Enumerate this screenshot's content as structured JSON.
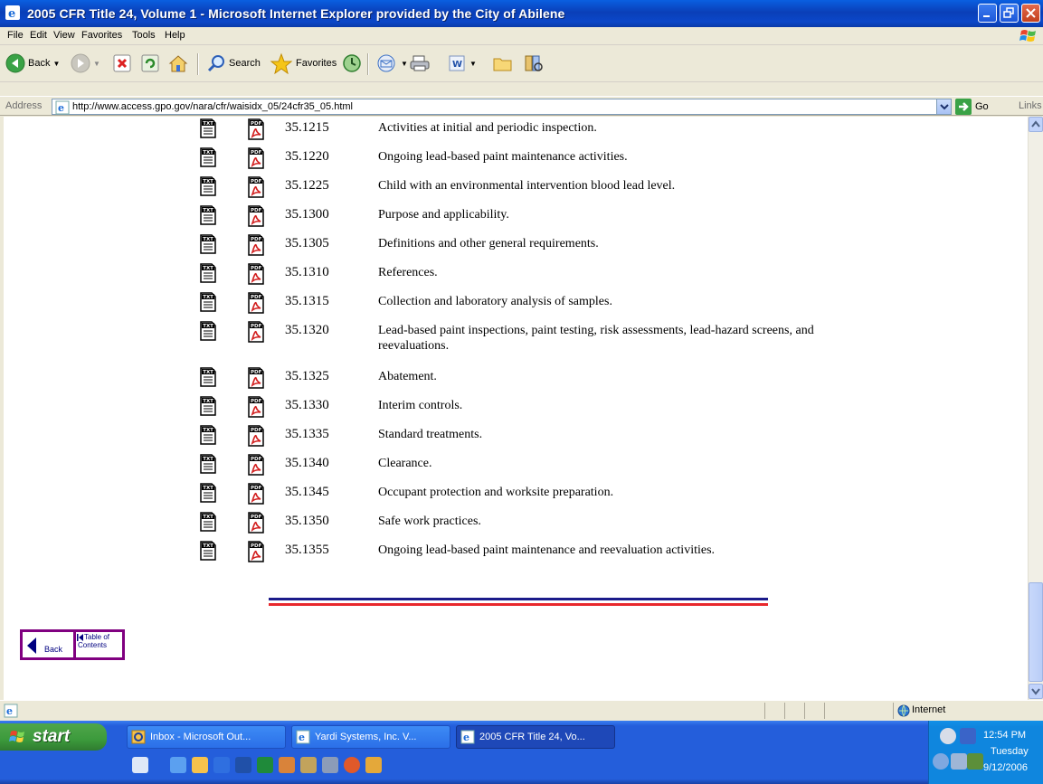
{
  "window": {
    "title": "2005 CFR Title 24, Volume 1 - Microsoft Internet Explorer provided by the City of Abilene"
  },
  "menu": [
    "File",
    "Edit",
    "View",
    "Favorites",
    "Tools",
    "Help"
  ],
  "toolbar": {
    "back_label": "Back",
    "search_label": "Search",
    "favorites_label": "Favorites"
  },
  "address": {
    "label": "Address",
    "url": "http://www.access.gpo.gov/nara/cfr/waisidx_05/24cfr35_05.html",
    "go_label": "Go",
    "links_label": "Links"
  },
  "sections": [
    {
      "number": "35.1215",
      "title": "Activities at initial and periodic inspection."
    },
    {
      "number": "35.1220",
      "title": "Ongoing lead-based paint maintenance activities."
    },
    {
      "number": "35.1225",
      "title": "Child with an environmental intervention blood lead level."
    },
    {
      "number": "35.1300",
      "title": "Purpose and applicability."
    },
    {
      "number": "35.1305",
      "title": "Definitions and other general requirements."
    },
    {
      "number": "35.1310",
      "title": "References."
    },
    {
      "number": "35.1315",
      "title": "Collection and laboratory analysis of samples."
    },
    {
      "number": "35.1320",
      "title": "Lead-based paint inspections, paint testing, risk assessments, lead-hazard screens, and reevaluations."
    },
    {
      "number": "35.1325",
      "title": "Abatement."
    },
    {
      "number": "35.1330",
      "title": "Interim controls."
    },
    {
      "number": "35.1335",
      "title": "Standard treatments."
    },
    {
      "number": "35.1340",
      "title": "Clearance."
    },
    {
      "number": "35.1345",
      "title": "Occupant protection and worksite preparation."
    },
    {
      "number": "35.1350",
      "title": "Safe work practices."
    },
    {
      "number": "35.1355",
      "title": "Ongoing lead-based paint maintenance and reevaluation activities."
    }
  ],
  "nav": {
    "back_label": "Back",
    "toc_label_1": "Table of",
    "toc_label_2": "Contents"
  },
  "status": {
    "zone": "Internet"
  },
  "taskbar": {
    "start_label": "start",
    "tasks": [
      {
        "label": "Inbox - Microsoft Out..."
      },
      {
        "label": "Yardi Systems, Inc. V..."
      },
      {
        "label": "2005 CFR Title 24, Vo..."
      }
    ],
    "clock": {
      "time": "12:54 PM",
      "day": "Tuesday",
      "date": "9/12/2006"
    }
  }
}
